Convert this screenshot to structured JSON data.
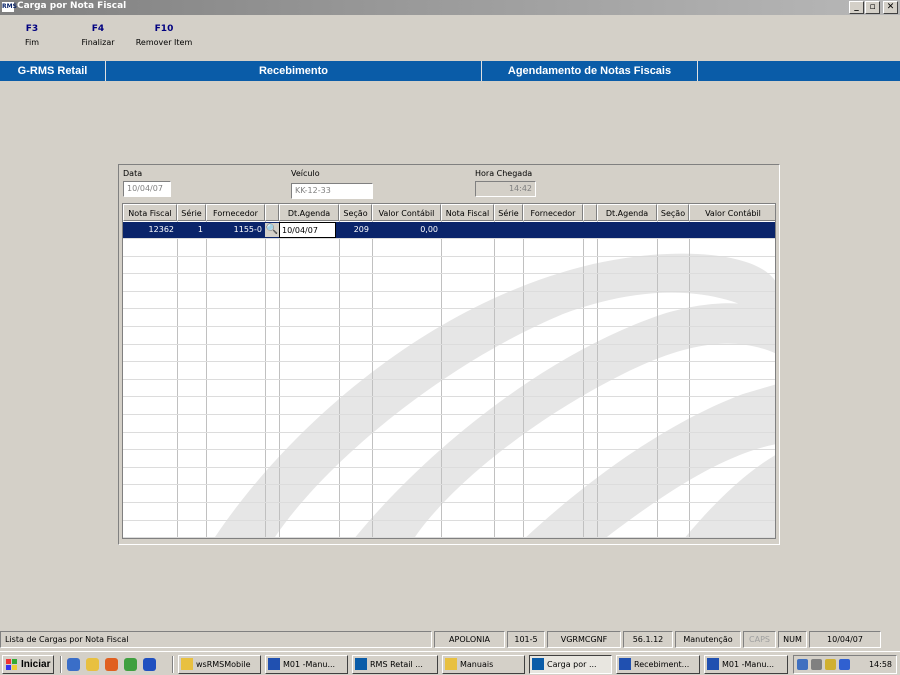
{
  "window": {
    "title": "Carga por Nota Fiscal",
    "app_icon_text": "RMS",
    "min_label": "_",
    "max_label": "▫",
    "close_label": "✕"
  },
  "fkeys": [
    {
      "key": "F3",
      "label": "Fim"
    },
    {
      "key": "F4",
      "label": "Finalizar"
    },
    {
      "key": "F10",
      "label": "Remover Item"
    }
  ],
  "modbar": {
    "app": "G-RMS Retail",
    "module": "Recebimento",
    "screen": "Agendamento de Notas Fiscais"
  },
  "form": {
    "data_label": "Data",
    "data_value": "10/04/07",
    "veiculo_label": "Veículo",
    "veiculo_value": "KK-12-33",
    "hora_label": "Hora Chegada",
    "hora_value": "14:42"
  },
  "grid": {
    "columns": [
      "Nota Fiscal",
      "Série",
      "Fornecedor",
      "",
      "Dt.Agenda",
      "Seção",
      "Valor Contábil",
      "Nota Fiscal",
      "Série",
      "Fornecedor",
      "",
      "Dt.Agenda",
      "Seção",
      "Valor Contábil"
    ],
    "row": {
      "nota": "12362",
      "serie": "1",
      "fornecedor": "1155-0",
      "dt_agenda": "10/04/07",
      "secao": "209",
      "valor": "0,00"
    }
  },
  "status": {
    "message": "Lista de Cargas por Nota Fiscal",
    "cells": [
      "APOLONIA",
      "101-5",
      "VGRMCGNF",
      "56.1.12",
      "Manutenção",
      "CAPS",
      "NUM",
      "10/04/07"
    ]
  },
  "taskbar": {
    "start": "Iniciar",
    "tasks": [
      "wsRMSMobile",
      "M01 -Manu...",
      "RMS Retail ...",
      "Manuais",
      "Carga por ...",
      "Recebiment...",
      "M01 -Manu..."
    ],
    "clock": "14:58"
  },
  "colors": {
    "module_bar": "#0a5ca8",
    "selection": "#0a246a",
    "face": "#d4d0c8"
  }
}
